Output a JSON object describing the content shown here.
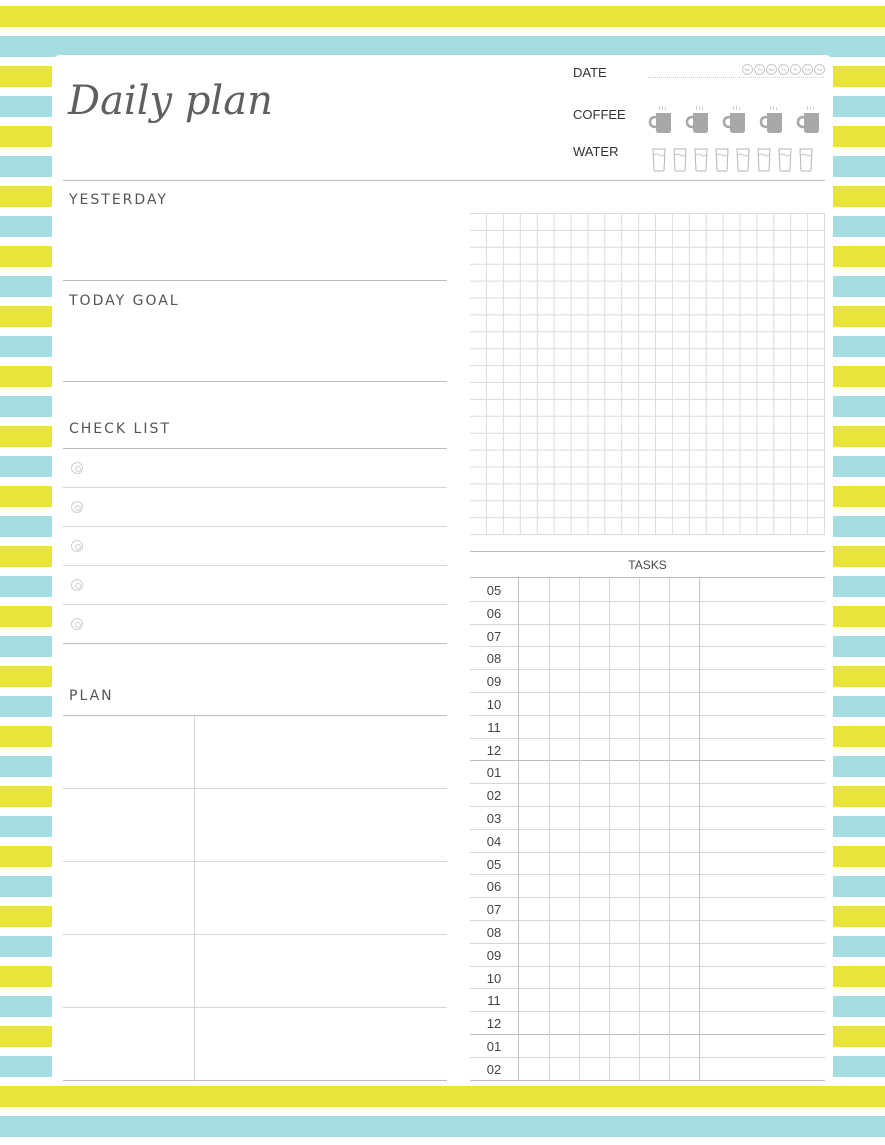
{
  "header": {
    "title": "Daily plan",
    "date_label": "DATE",
    "weekdays": [
      "Mo",
      "Tu",
      "We",
      "Th",
      "Fr",
      "Sa",
      "Su"
    ],
    "coffee_label": "COFFEE",
    "coffee_count": 5,
    "water_label": "WATER",
    "water_count": 8
  },
  "colors": {
    "stripe_yellow": "#e8e53a",
    "stripe_cyan": "#a6dde2",
    "text": "#555555",
    "line": "#bdbdbd",
    "icon": "#a8a8a8"
  },
  "sections": {
    "yesterday": "YESTERDAY",
    "today_goal": "TODAY GOAL",
    "check_list": "CHECK LIST",
    "plan": "PLAN"
  },
  "checklist": {
    "item_count": 5
  },
  "plan": {
    "row_count": 5
  },
  "tasks": {
    "title": "TASKS",
    "hours": [
      "05",
      "06",
      "07",
      "08",
      "09",
      "10",
      "11",
      "12",
      "01",
      "02",
      "03",
      "04",
      "05",
      "06",
      "07",
      "08",
      "09",
      "10",
      "11",
      "12",
      "01",
      "02"
    ]
  }
}
